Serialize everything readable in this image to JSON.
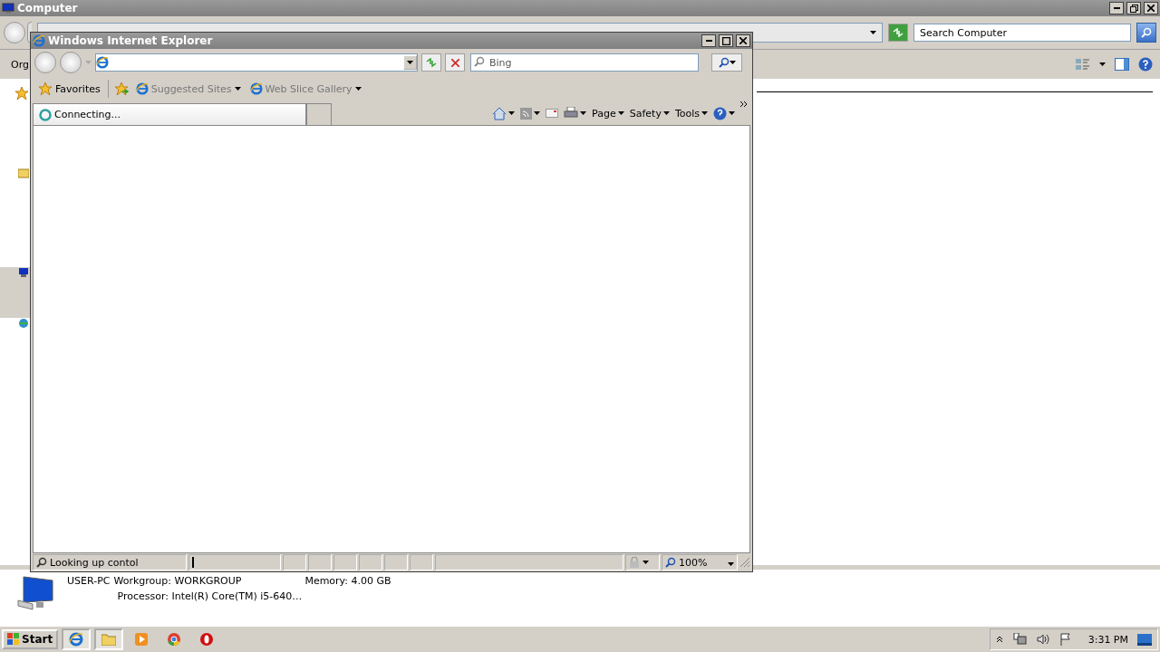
{
  "explorer": {
    "title": "Computer",
    "search": {
      "placeholder": "Search Computer"
    },
    "toolbar_label": "Org",
    "details": {
      "computer_name": "USER-PC",
      "fields": [
        {
          "label": "Workgroup:",
          "value": "WORKGROUP"
        },
        {
          "label": "Memory:",
          "value": "4.00 GB"
        },
        {
          "label": "Processor:",
          "value": "Intel(R) Core(TM) i5-640…"
        }
      ]
    }
  },
  "browser": {
    "title": "Windows Internet Explorer",
    "search": {
      "placeholder": "Bing"
    },
    "favorites_bar": {
      "label": "Favorites",
      "links": [
        {
          "label": "Suggested Sites"
        },
        {
          "label": "Web Slice Gallery"
        }
      ]
    },
    "tabs": [
      {
        "label": "Connecting...",
        "selected": true
      }
    ],
    "commands": [
      {
        "label": "Page"
      },
      {
        "label": "Safety"
      },
      {
        "label": "Tools"
      }
    ],
    "status_bar": {
      "text": "Looking up contol",
      "zoom": "100%"
    }
  },
  "taskbar": {
    "start": "Start",
    "apps": [
      {
        "kind": "ie",
        "active": true
      },
      {
        "kind": "folder",
        "active": true
      },
      {
        "kind": "media",
        "active": false
      },
      {
        "kind": "chrome",
        "active": false
      },
      {
        "kind": "opera",
        "active": false
      }
    ],
    "clock": "3:31 PM"
  }
}
